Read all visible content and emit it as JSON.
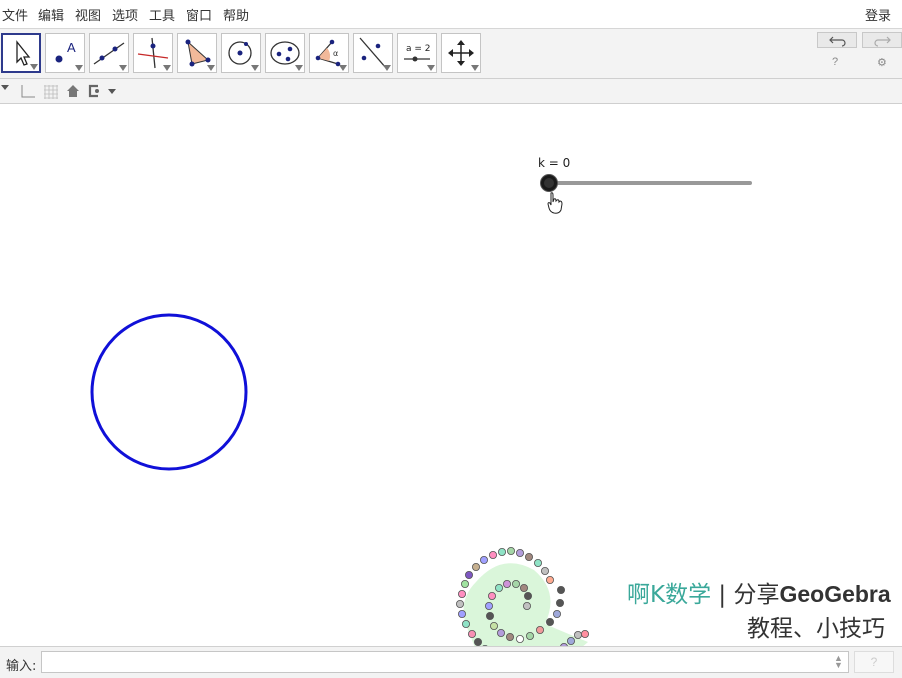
{
  "menu": {
    "items": [
      "文件",
      "编辑",
      "视图",
      "选项",
      "工具",
      "窗口",
      "帮助"
    ],
    "login": "登录"
  },
  "toolbar": {
    "tools": [
      {
        "name": "move-tool",
        "icon": "arrow-icon"
      },
      {
        "name": "point-tool",
        "icon": "point-icon",
        "label": "A"
      },
      {
        "name": "line-tool",
        "icon": "line-icon"
      },
      {
        "name": "perpendicular-line-tool",
        "icon": "perpendicular-icon"
      },
      {
        "name": "polygon-tool",
        "icon": "polygon-icon"
      },
      {
        "name": "circle-tool",
        "icon": "circle-center-icon"
      },
      {
        "name": "ellipse-tool",
        "icon": "ellipse-icon"
      },
      {
        "name": "angle-tool",
        "icon": "angle-icon",
        "label": "α"
      },
      {
        "name": "reflect-tool",
        "icon": "reflect-icon"
      },
      {
        "name": "slider-tool",
        "icon": "slider-icon",
        "label": "a = 2"
      },
      {
        "name": "move-graphics-tool",
        "icon": "move-arrows-icon"
      }
    ],
    "undo_icon": "undo-icon",
    "redo_icon": "redo-icon",
    "help_icon": "?",
    "settings_icon": "⚙"
  },
  "graphics": {
    "slider_label": "k = 0",
    "slider_value": 0,
    "circle_color": "#1010d8"
  },
  "watermark": {
    "line1_accent": "啊K数学",
    "line1_sep": " | ",
    "line1_text": "分享",
    "line1_brand": "GeoGebra",
    "line2": "教程、小技巧",
    "accent_color": "#3aa89a"
  },
  "input_bar": {
    "label": "输入:",
    "value": "",
    "placeholder": "",
    "help": "?"
  }
}
